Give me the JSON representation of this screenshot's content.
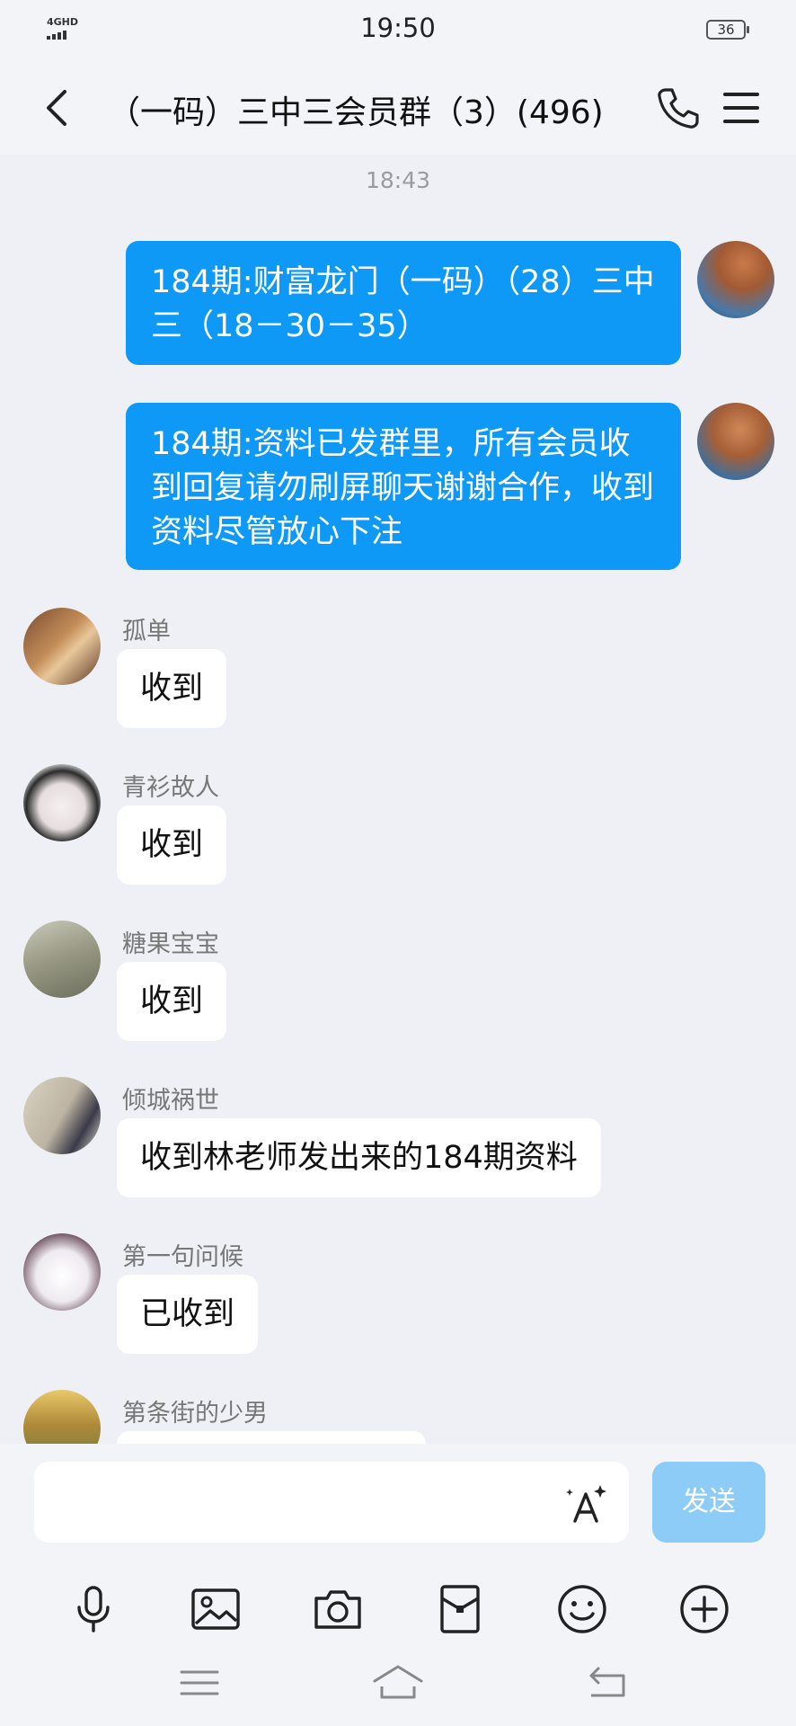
{
  "status": {
    "network": "4GHD",
    "time": "19:50",
    "battery": "36"
  },
  "header": {
    "title": "（一码）三中三会员群（3）(496)"
  },
  "chat": {
    "timestamp": "18:43",
    "sent": [
      {
        "text": "184期:财富龙门（一码）（28）三中三（18－30－35）"
      },
      {
        "text": "184期:资料已发群里，所有会员收到回复请勿刷屏聊天谢谢合作，收到资料尽管放心下注"
      }
    ],
    "received": [
      {
        "name": "孤单",
        "text": "收到"
      },
      {
        "name": "青衫故人",
        "text": "收到"
      },
      {
        "name": "糖果宝宝",
        "text": "收到"
      },
      {
        "name": "倾城祸世",
        "text": "收到林老师发出来的184期资料"
      },
      {
        "name": "第一句问候",
        "text": "已收到"
      },
      {
        "name": "第条街的少男",
        "text": ""
      }
    ]
  },
  "input": {
    "value": "",
    "send_label": "发送"
  },
  "colors": {
    "accent": "#0f99f7",
    "send_disabled": "#8cccf7",
    "background": "#eef0f5"
  },
  "icons": [
    "mic-icon",
    "image-icon",
    "camera-icon",
    "red-packet-icon",
    "emoji-icon",
    "plus-icon"
  ]
}
